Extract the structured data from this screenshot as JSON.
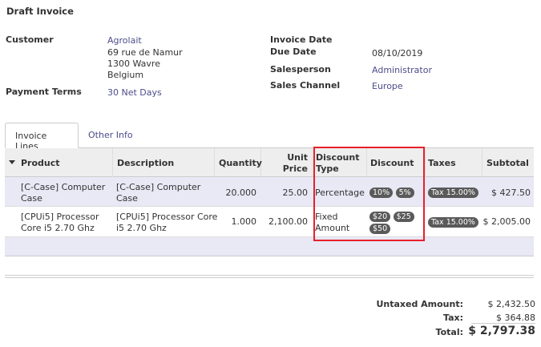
{
  "header": {
    "title": "Draft Invoice"
  },
  "form": {
    "customer_label": "Customer",
    "customer_name": "Agrolait",
    "customer_address": [
      "69 rue de Namur",
      "1300 Wavre",
      "Belgium"
    ],
    "payment_terms_label": "Payment Terms",
    "payment_terms_value": "30 Net Days",
    "invoice_date_label": "Invoice Date",
    "invoice_date_value": "",
    "due_date_label": "Due Date",
    "due_date_value": "08/10/2019",
    "salesperson_label": "Salesperson",
    "salesperson_value": "Administrator",
    "sales_channel_label": "Sales Channel",
    "sales_channel_value": "Europe"
  },
  "tabs": [
    {
      "label": "Invoice Lines",
      "active": true
    },
    {
      "label": "Other Info",
      "active": false
    }
  ],
  "table": {
    "headers": {
      "product": "Product",
      "description": "Description",
      "quantity": "Quantity",
      "unit_price_1": "Unit",
      "unit_price_2": "Price",
      "discount_type_1": "Discount",
      "discount_type_2": "Type",
      "discount": "Discount",
      "taxes": "Taxes",
      "subtotal": "Subtotal"
    },
    "rows": [
      {
        "product": [
          "[C-Case] Computer",
          "Case"
        ],
        "description": [
          "[C-Case] Computer",
          "Case"
        ],
        "quantity": "20.000",
        "unit_price": "25.00",
        "discount_type": [
          "Percentage"
        ],
        "discounts": [
          "10%",
          "5%"
        ],
        "tax": "Tax 15.00%",
        "subtotal": "$ 427.50"
      },
      {
        "product": [
          "[CPUi5] Processor",
          "Core i5 2.70 Ghz"
        ],
        "description": [
          "[CPUi5] Processor Core",
          "i5 2.70 Ghz"
        ],
        "quantity": "1.000",
        "unit_price": "2,100.00",
        "discount_type": [
          "Fixed",
          "Amount"
        ],
        "discounts": [
          "$20",
          "$25",
          "$50"
        ],
        "tax": "Tax 15.00%",
        "subtotal": "$ 2,005.00"
      }
    ]
  },
  "totals": {
    "untaxed_label": "Untaxed Amount:",
    "untaxed_value": "$ 2,432.50",
    "tax_label": "Tax:",
    "tax_value": "$ 364.88",
    "total_label": "Total:",
    "total_value": "$ 2,797.38"
  },
  "colors": {
    "highlight": "#e8202a",
    "link": "#4c4c8a",
    "row_alt": "#e9e8f5",
    "badge": "#5a5a5a"
  }
}
